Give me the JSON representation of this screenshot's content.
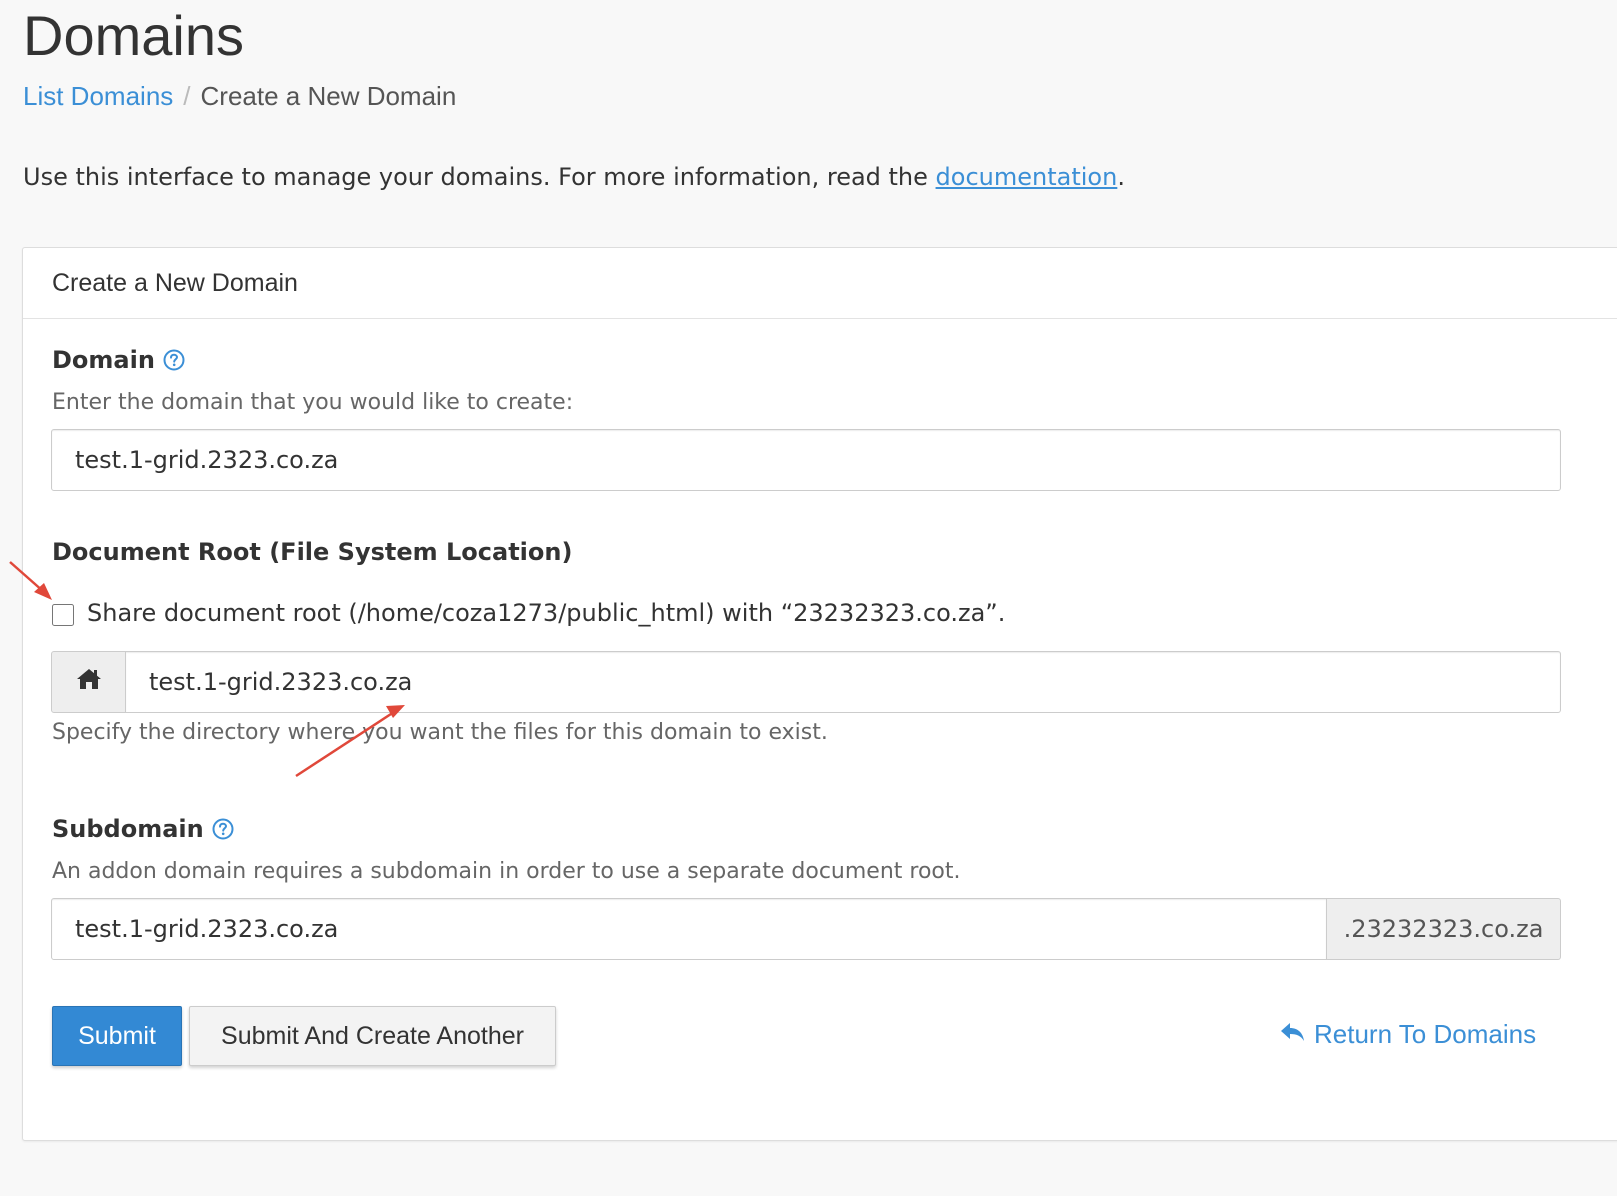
{
  "page": {
    "title": "Domains"
  },
  "breadcrumb": {
    "link_label": "List Domains",
    "separator": "/",
    "current": "Create a New Domain"
  },
  "intro": {
    "text": "Use this interface to manage your domains. For more information, read the ",
    "link_label": "documentation",
    "suffix": "."
  },
  "panel": {
    "heading": "Create a New Domain",
    "domain": {
      "label": "Domain",
      "help_icon": "question-circle-icon",
      "help_text": "Enter the domain that you would like to create:",
      "value": "test.1-grid.2323.co.za"
    },
    "document_root": {
      "label": "Document Root (File System Location)",
      "share_checkbox_checked": false,
      "share_label": "Share document root (/home/coza1273/public_html) with “23232323.co.za”.",
      "addon_icon": "home-icon",
      "value": "test.1-grid.2323.co.za",
      "help_text": "Specify the directory where you want the files for this domain to exist."
    },
    "subdomain": {
      "label": "Subdomain",
      "help_icon": "question-circle-icon",
      "help_text": "An addon domain requires a subdomain in order to use a separate document root.",
      "value": "test.1-grid.2323.co.za",
      "suffix": ".23232323.co.za"
    },
    "actions": {
      "submit_label": "Submit",
      "submit_another_label": "Submit And Create Another",
      "return_icon": "reply-arrow-icon",
      "return_label": "Return To Domains"
    }
  },
  "colors": {
    "accent": "#3389d4",
    "link": "#3b8fd6",
    "annotation_arrow": "#e0483a"
  }
}
